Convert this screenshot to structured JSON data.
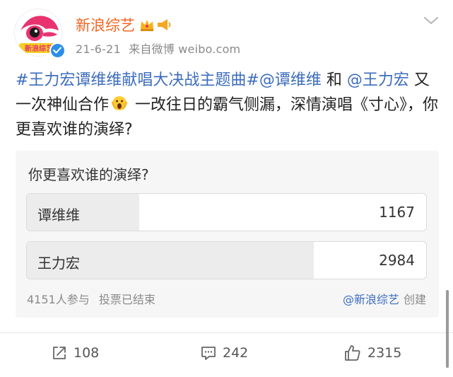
{
  "post": {
    "username": "新浪综艺",
    "date": "21-6-21",
    "source": "来自微博 weibo.com",
    "avatar_text": "新浪综艺",
    "content": {
      "hashtag": "#王力宏谭维维献唱大决战主题曲#",
      "mention1": "@谭维维",
      "and": " 和 ",
      "mention2": "@王力宏",
      "text1": " 又一次神仙合作",
      "text2": " 一改往日的霸气侧漏，深情演唱《寸心》，你更喜欢谁的演绎?"
    }
  },
  "poll": {
    "question": "你更喜欢谁的演绎?",
    "options": [
      {
        "label": "谭维维",
        "count": "1167",
        "fraction": 0.281
      },
      {
        "label": "王力宏",
        "count": "2984",
        "fraction": 0.719
      }
    ],
    "participants": "4151人参与",
    "status": "投票已结束",
    "creator": "@新浪综艺",
    "created_label": "创建"
  },
  "actions": {
    "share_count": "108",
    "comment_count": "242",
    "like_count": "2315"
  },
  "colors": {
    "username": "#f26522",
    "link": "#3d6dbd",
    "verified": "#2b8ee8"
  }
}
